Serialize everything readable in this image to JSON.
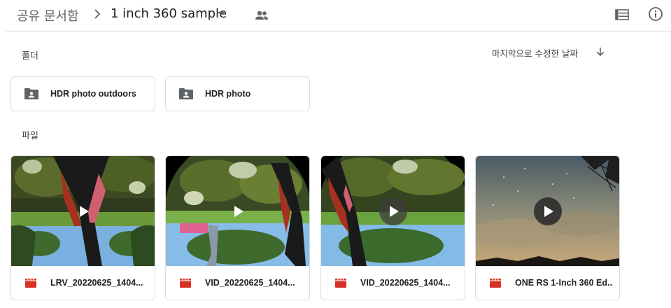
{
  "breadcrumb": {
    "root": "공유 문서함",
    "current": "1 inch 360 sample"
  },
  "icons": {
    "shared": "people-icon",
    "list_view": "list-view-icon",
    "info": "info-icon"
  },
  "sort": {
    "label": "마지막으로 수정한 날짜",
    "direction": "descending"
  },
  "sections": {
    "folders_label": "폴더",
    "files_label": "파일"
  },
  "folders": [
    {
      "name": "HDR photo outdoors"
    },
    {
      "name": "HDR photo"
    }
  ],
  "files": [
    {
      "name": "LRV_20220625_1404..."
    },
    {
      "name": "VID_20220625_1404..."
    },
    {
      "name": "VID_20220625_1404..."
    },
    {
      "name": "ONE RS 1-Inch 360 Ed..."
    }
  ],
  "colors": {
    "video_icon": "#d93025",
    "folder_icon": "#5f6368",
    "border": "#dadce0"
  }
}
